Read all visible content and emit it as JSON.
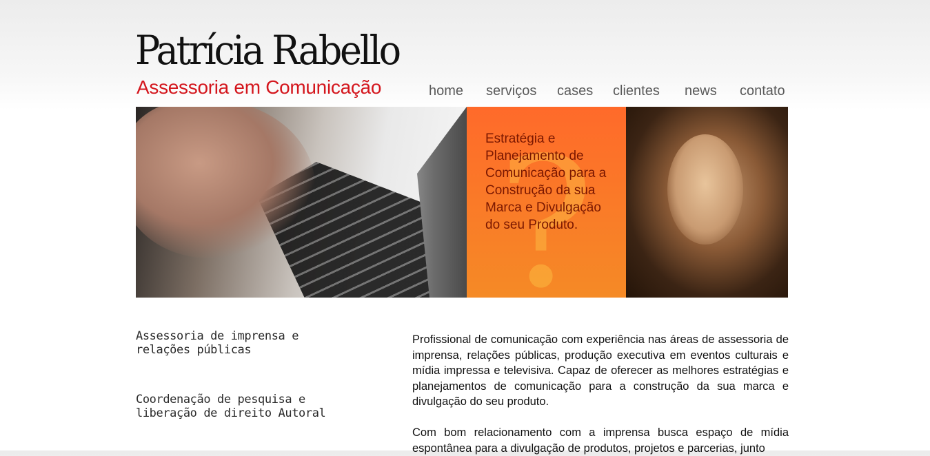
{
  "brand": {
    "name": "Patrícia Rabello",
    "subtitle": "Assessoria em Comunicação"
  },
  "nav": {
    "items": [
      "home",
      "serviços",
      "cases",
      "clientes",
      "news",
      "contato"
    ]
  },
  "banner": {
    "tagline": "Estratégia e Planejamento de Comunicação para a Construção da sua Marca e Divulgação do seu Produto."
  },
  "services": {
    "items": [
      "Assessoria de imprensa e relações públicas",
      "Coordenação de pesquisa e liberação de direito Autoral"
    ]
  },
  "content": {
    "paragraphs": [
      "Profissional de comunicação com experiência nas áreas de assessoria de imprensa, relações públicas, produção executiva em eventos culturais e mídia impressa e televisiva. Capaz de oferecer as melhores estratégias e planejamentos de comunicação para a construção da sua marca e divulgação do seu produto.",
      "Com bom relacionamento com a imprensa busca espaço de mídia espontânea para a divulgação de produtos, projetos e parcerias, junto"
    ]
  },
  "colors": {
    "accent_red": "#d4161d",
    "banner_orange": "#ff6a2a",
    "nav_text": "#5a5a5a"
  }
}
